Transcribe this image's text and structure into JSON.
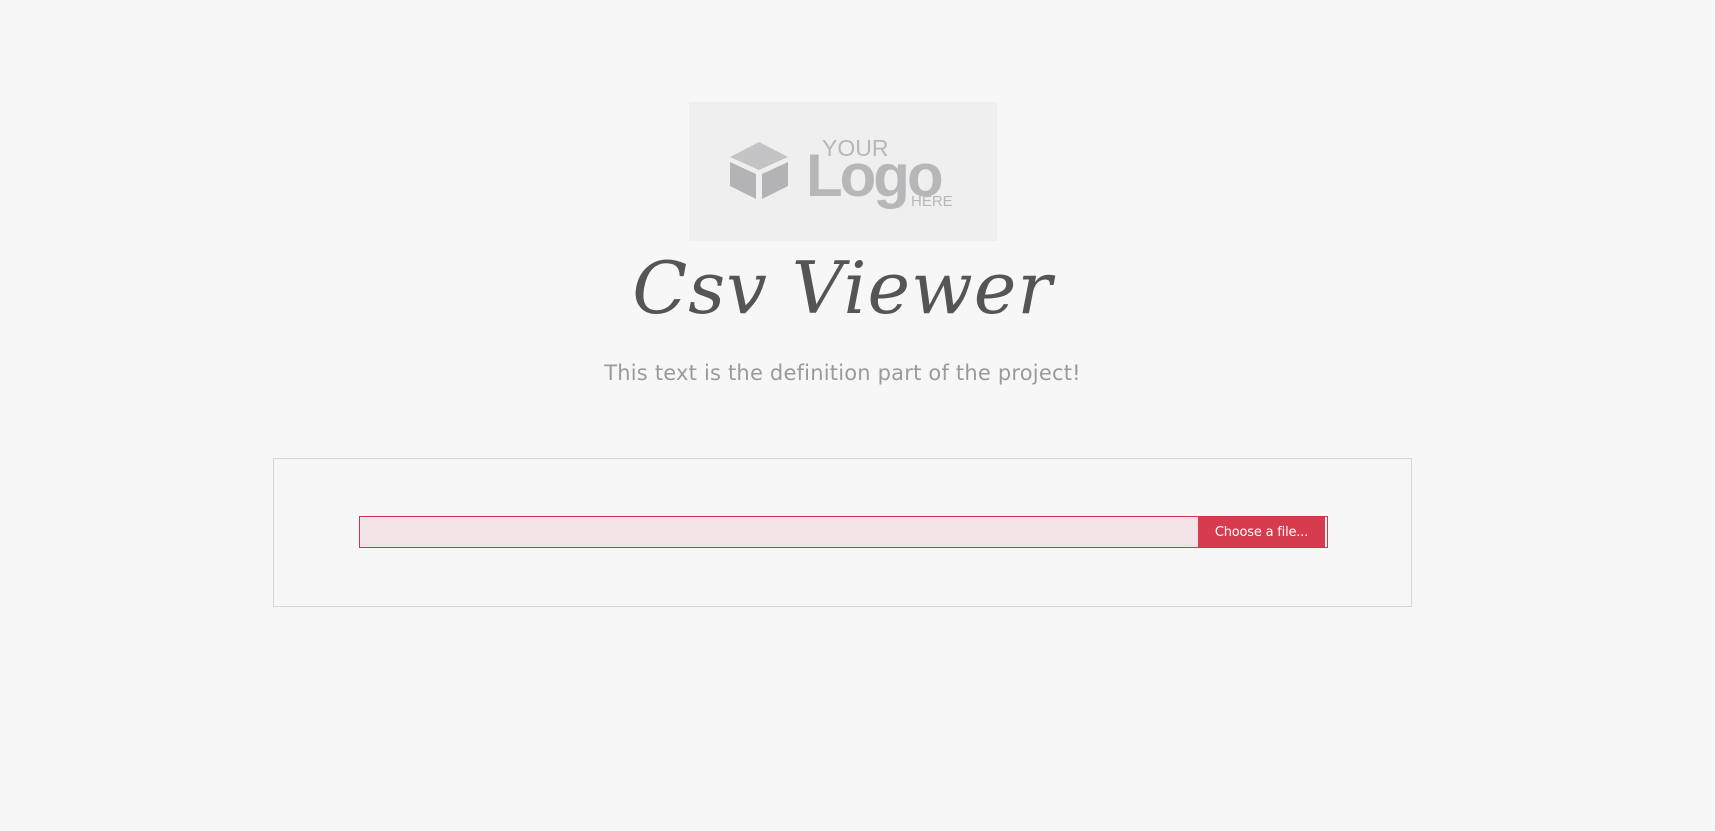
{
  "logo": {
    "line1": "YOUR",
    "line2": "Logo",
    "line3": "HERE"
  },
  "header": {
    "title": "Csv Viewer",
    "subtitle": "This text is the definition part of the project!"
  },
  "upload": {
    "file_name_value": "",
    "file_name_placeholder": "",
    "choose_file_label": "Choose a file..."
  },
  "colors": {
    "accent": "#d63b4e",
    "input_background": "#f2e4e6",
    "page_background": "#f7f7f7",
    "logo_gray": "#b7b7b9"
  }
}
